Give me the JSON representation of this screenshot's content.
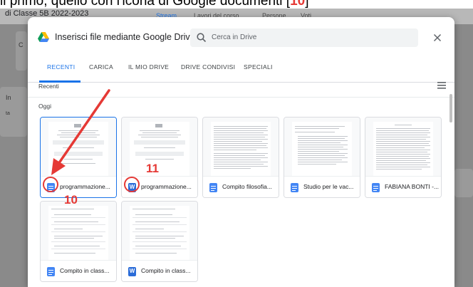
{
  "caption": {
    "text": "il primo, quello con l'icona di Google documenti [",
    "number": "10",
    "tail": "]"
  },
  "background": {
    "class_title": "di Classe 5B 2022-2023",
    "tabs": [
      "Stream",
      "Lavori del corso",
      "Persone",
      "Voti"
    ],
    "letters": [
      "C",
      "In",
      "ta"
    ]
  },
  "dialog": {
    "title": "Inserisci file mediante Google Drive",
    "search_placeholder": "Cerca in Drive",
    "tabs": [
      "RECENTI",
      "CARICA",
      "IL MIO DRIVE",
      "DRIVE CONDIVISI",
      "SPECIALI"
    ],
    "active_tab": "RECENTI",
    "section_recent": "Recenti",
    "section_today": "Oggi",
    "files": [
      {
        "name": "programmazione...",
        "icon": "google-docs-icon",
        "selected": true
      },
      {
        "name": "programmazione...",
        "icon": "word-icon",
        "selected": false
      },
      {
        "name": "Compito filosofia...",
        "icon": "google-docs-icon",
        "selected": false
      },
      {
        "name": "Studio per le vac...",
        "icon": "google-docs-icon",
        "selected": false
      },
      {
        "name": "FABIANA BONTI -...",
        "icon": "google-docs-icon",
        "selected": false
      },
      {
        "name": "Compito in class...",
        "icon": "google-docs-icon",
        "selected": false
      },
      {
        "name": "Compito in class...",
        "icon": "word-icon",
        "selected": false
      }
    ]
  },
  "annotations": {
    "label_10": "10",
    "label_11": "11"
  },
  "colors": {
    "accent": "#1a73e8",
    "annotation": "#e53935",
    "doc_icon": "#4285f4",
    "word_icon": "#2b6cd8"
  }
}
